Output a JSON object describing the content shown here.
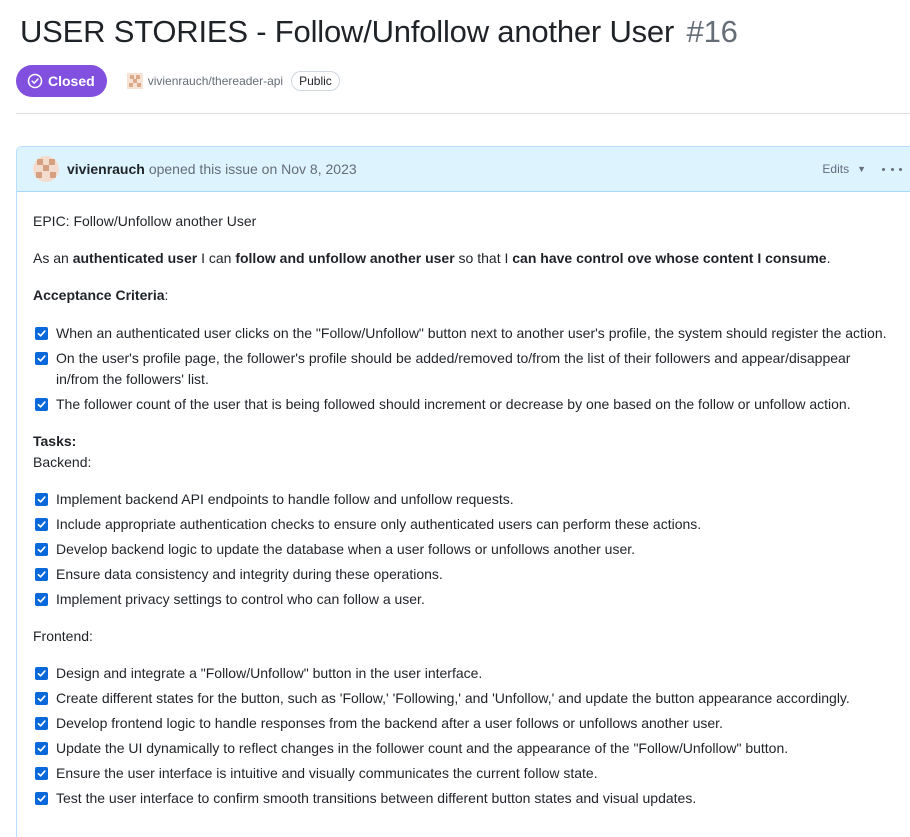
{
  "issue": {
    "title": "USER STORIES - Follow/Unfollow another User",
    "number": "#16",
    "state": "Closed",
    "state_color": "#8250df",
    "repo": "vivienrauch/thereader-api",
    "visibility": "Public"
  },
  "comment": {
    "author": "vivienrauch",
    "opened_text": "opened this issue on Nov 8, 2023",
    "edits_label": "Edits",
    "epic": "EPIC: Follow/Unfollow another User",
    "story": {
      "t1": "As an ",
      "b1": "authenticated user",
      "t2": " I can ",
      "b2": "follow and unfollow another user",
      "t3": " so that I ",
      "b3": "can have control ove whose content I consume",
      "t4": "."
    },
    "acceptance_heading": "Acceptance Criteria",
    "acceptance_colon": ":",
    "acceptance": [
      "When an authenticated user clicks on the \"Follow/Unfollow\" button next to another user's profile, the system should register the action.",
      "On the user's profile page, the follower's profile should be added/removed to/from the list of their followers and appear/disappear in/from the followers' list.",
      "The follower count of the user that is being followed should increment or decrease by one based on the follow or unfollow action."
    ],
    "tasks_heading": "Tasks:",
    "backend_label": "Backend:",
    "backend": [
      "Implement backend API endpoints to handle follow and unfollow requests.",
      "Include appropriate authentication checks to ensure only authenticated users can perform these actions.",
      "Develop backend logic to update the database when a user follows or unfollows another user.",
      "Ensure data consistency and integrity during these operations.",
      "Implement privacy settings to control who can follow a user."
    ],
    "frontend_label": "Frontend:",
    "frontend": [
      "Design and integrate a \"Follow/Unfollow\" button in the user interface.",
      "Create different states for the button, such as 'Follow,' 'Following,' and 'Unfollow,' and update the button appearance accordingly.",
      "Develop frontend logic to handle responses from the backend after a user follows or unfollows another user.",
      "Update the UI dynamically to reflect changes in the follower count and the appearance of the \"Follow/Unfollow\" button.",
      "Ensure the user interface is intuitive and visually communicates the current follow state.",
      "Test the user interface to confirm smooth transitions between different button states and visual updates."
    ]
  },
  "colors": {
    "checkbox": "#0969da",
    "header_bg": "#ddf4ff"
  }
}
